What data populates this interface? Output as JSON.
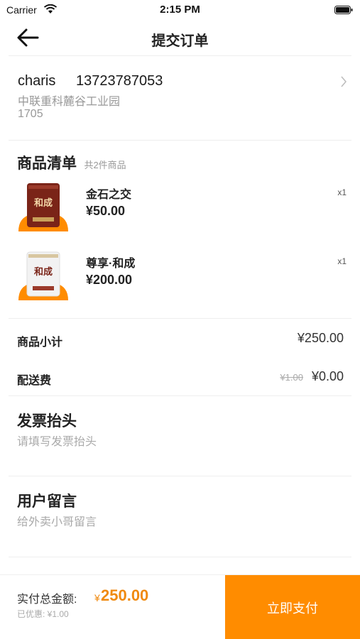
{
  "status_bar": {
    "carrier": "Carrier",
    "time": "2:15 PM"
  },
  "nav": {
    "title": "提交订单"
  },
  "address": {
    "name": "charis",
    "phone": "13723787053",
    "line1": "中联重科麓谷工业园",
    "line2": "1705"
  },
  "goods": {
    "title": "商品清单",
    "count": "共2件商品",
    "items": [
      {
        "name": "金石之交",
        "price": "¥50.00",
        "qty": "x1",
        "package_color": "#7a2418"
      },
      {
        "name": "尊享·和成",
        "price": "¥200.00",
        "qty": "x1",
        "package_color": "#f2f2f2"
      }
    ]
  },
  "summary": {
    "subtotal_label": "商品小计",
    "subtotal_value": "¥250.00",
    "delivery_label": "配送费",
    "delivery_original": "¥1.00",
    "delivery_value": "¥0.00"
  },
  "invoice": {
    "title": "发票抬头",
    "placeholder": "请填写发票抬头"
  },
  "message": {
    "title": "用户留言",
    "placeholder": "给外卖小哥留言"
  },
  "footer": {
    "total_label": "实付总金额:",
    "currency": "¥",
    "total_amount": "250.00",
    "discount": "已优惠: ¥1.00",
    "pay_label": "立即支付"
  },
  "colors": {
    "accent": "#ff8c00",
    "price_text": "#f08a10"
  }
}
